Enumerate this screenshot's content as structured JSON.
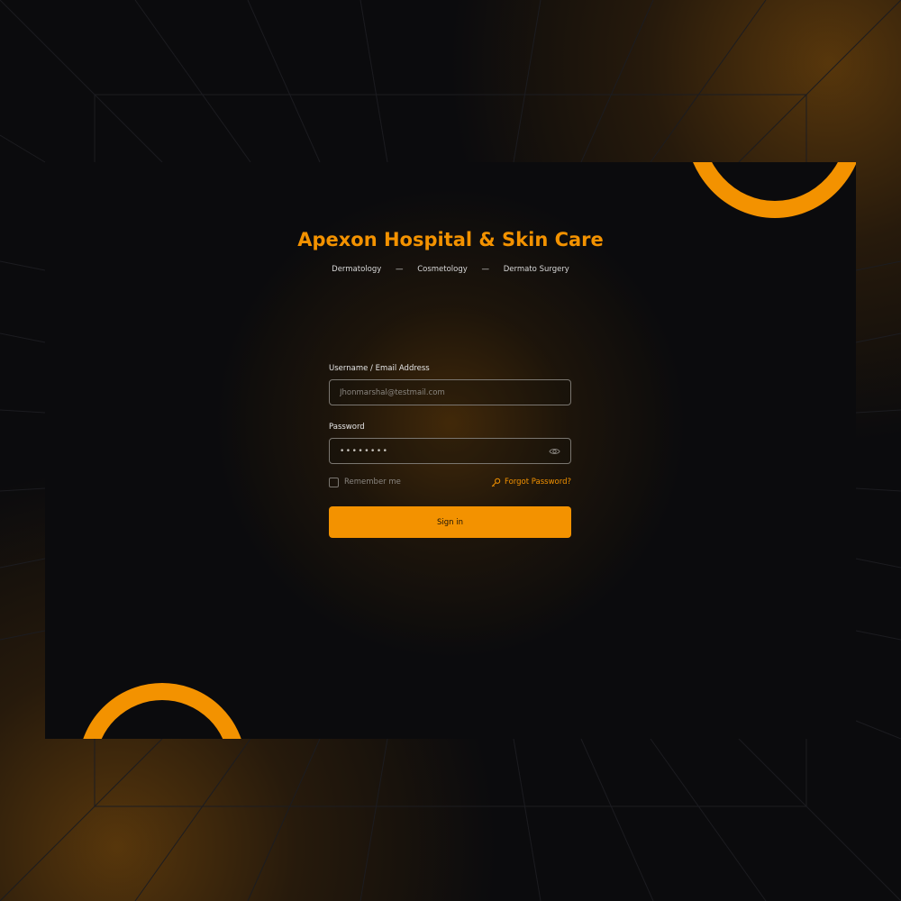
{
  "brand": {
    "title": "Apexon Hospital & Skin Care",
    "specialties": [
      "Dermatology",
      "Cosmetology",
      "Dermato Surgery"
    ],
    "separator": "—",
    "accent_color": "#f39200"
  },
  "form": {
    "username_label": "Username / Email Address",
    "username_placeholder": "Jhonmarshal@testmail.com",
    "password_label": "Password",
    "password_value": "••••••••",
    "password_toggle_icon": "eye-icon",
    "remember_label": "Remember me",
    "forgot_label": "Forgot Password?",
    "forgot_icon": "key-icon",
    "signin_label": "Sign in"
  }
}
